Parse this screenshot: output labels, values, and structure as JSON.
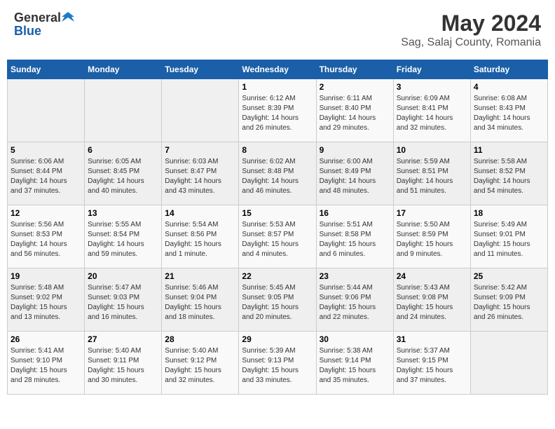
{
  "logo": {
    "general": "General",
    "blue": "Blue"
  },
  "title": "May 2024",
  "subtitle": "Sag, Salaj County, Romania",
  "days_header": [
    "Sunday",
    "Monday",
    "Tuesday",
    "Wednesday",
    "Thursday",
    "Friday",
    "Saturday"
  ],
  "weeks": [
    [
      {
        "day": "",
        "info": ""
      },
      {
        "day": "",
        "info": ""
      },
      {
        "day": "",
        "info": ""
      },
      {
        "day": "1",
        "info": "Sunrise: 6:12 AM\nSunset: 8:39 PM\nDaylight: 14 hours\nand 26 minutes."
      },
      {
        "day": "2",
        "info": "Sunrise: 6:11 AM\nSunset: 8:40 PM\nDaylight: 14 hours\nand 29 minutes."
      },
      {
        "day": "3",
        "info": "Sunrise: 6:09 AM\nSunset: 8:41 PM\nDaylight: 14 hours\nand 32 minutes."
      },
      {
        "day": "4",
        "info": "Sunrise: 6:08 AM\nSunset: 8:43 PM\nDaylight: 14 hours\nand 34 minutes."
      }
    ],
    [
      {
        "day": "5",
        "info": "Sunrise: 6:06 AM\nSunset: 8:44 PM\nDaylight: 14 hours\nand 37 minutes."
      },
      {
        "day": "6",
        "info": "Sunrise: 6:05 AM\nSunset: 8:45 PM\nDaylight: 14 hours\nand 40 minutes."
      },
      {
        "day": "7",
        "info": "Sunrise: 6:03 AM\nSunset: 8:47 PM\nDaylight: 14 hours\nand 43 minutes."
      },
      {
        "day": "8",
        "info": "Sunrise: 6:02 AM\nSunset: 8:48 PM\nDaylight: 14 hours\nand 46 minutes."
      },
      {
        "day": "9",
        "info": "Sunrise: 6:00 AM\nSunset: 8:49 PM\nDaylight: 14 hours\nand 48 minutes."
      },
      {
        "day": "10",
        "info": "Sunrise: 5:59 AM\nSunset: 8:51 PM\nDaylight: 14 hours\nand 51 minutes."
      },
      {
        "day": "11",
        "info": "Sunrise: 5:58 AM\nSunset: 8:52 PM\nDaylight: 14 hours\nand 54 minutes."
      }
    ],
    [
      {
        "day": "12",
        "info": "Sunrise: 5:56 AM\nSunset: 8:53 PM\nDaylight: 14 hours\nand 56 minutes."
      },
      {
        "day": "13",
        "info": "Sunrise: 5:55 AM\nSunset: 8:54 PM\nDaylight: 14 hours\nand 59 minutes."
      },
      {
        "day": "14",
        "info": "Sunrise: 5:54 AM\nSunset: 8:56 PM\nDaylight: 15 hours\nand 1 minute."
      },
      {
        "day": "15",
        "info": "Sunrise: 5:53 AM\nSunset: 8:57 PM\nDaylight: 15 hours\nand 4 minutes."
      },
      {
        "day": "16",
        "info": "Sunrise: 5:51 AM\nSunset: 8:58 PM\nDaylight: 15 hours\nand 6 minutes."
      },
      {
        "day": "17",
        "info": "Sunrise: 5:50 AM\nSunset: 8:59 PM\nDaylight: 15 hours\nand 9 minutes."
      },
      {
        "day": "18",
        "info": "Sunrise: 5:49 AM\nSunset: 9:01 PM\nDaylight: 15 hours\nand 11 minutes."
      }
    ],
    [
      {
        "day": "19",
        "info": "Sunrise: 5:48 AM\nSunset: 9:02 PM\nDaylight: 15 hours\nand 13 minutes."
      },
      {
        "day": "20",
        "info": "Sunrise: 5:47 AM\nSunset: 9:03 PM\nDaylight: 15 hours\nand 16 minutes."
      },
      {
        "day": "21",
        "info": "Sunrise: 5:46 AM\nSunset: 9:04 PM\nDaylight: 15 hours\nand 18 minutes."
      },
      {
        "day": "22",
        "info": "Sunrise: 5:45 AM\nSunset: 9:05 PM\nDaylight: 15 hours\nand 20 minutes."
      },
      {
        "day": "23",
        "info": "Sunrise: 5:44 AM\nSunset: 9:06 PM\nDaylight: 15 hours\nand 22 minutes."
      },
      {
        "day": "24",
        "info": "Sunrise: 5:43 AM\nSunset: 9:08 PM\nDaylight: 15 hours\nand 24 minutes."
      },
      {
        "day": "25",
        "info": "Sunrise: 5:42 AM\nSunset: 9:09 PM\nDaylight: 15 hours\nand 26 minutes."
      }
    ],
    [
      {
        "day": "26",
        "info": "Sunrise: 5:41 AM\nSunset: 9:10 PM\nDaylight: 15 hours\nand 28 minutes."
      },
      {
        "day": "27",
        "info": "Sunrise: 5:40 AM\nSunset: 9:11 PM\nDaylight: 15 hours\nand 30 minutes."
      },
      {
        "day": "28",
        "info": "Sunrise: 5:40 AM\nSunset: 9:12 PM\nDaylight: 15 hours\nand 32 minutes."
      },
      {
        "day": "29",
        "info": "Sunrise: 5:39 AM\nSunset: 9:13 PM\nDaylight: 15 hours\nand 33 minutes."
      },
      {
        "day": "30",
        "info": "Sunrise: 5:38 AM\nSunset: 9:14 PM\nDaylight: 15 hours\nand 35 minutes."
      },
      {
        "day": "31",
        "info": "Sunrise: 5:37 AM\nSunset: 9:15 PM\nDaylight: 15 hours\nand 37 minutes."
      },
      {
        "day": "",
        "info": ""
      }
    ]
  ]
}
